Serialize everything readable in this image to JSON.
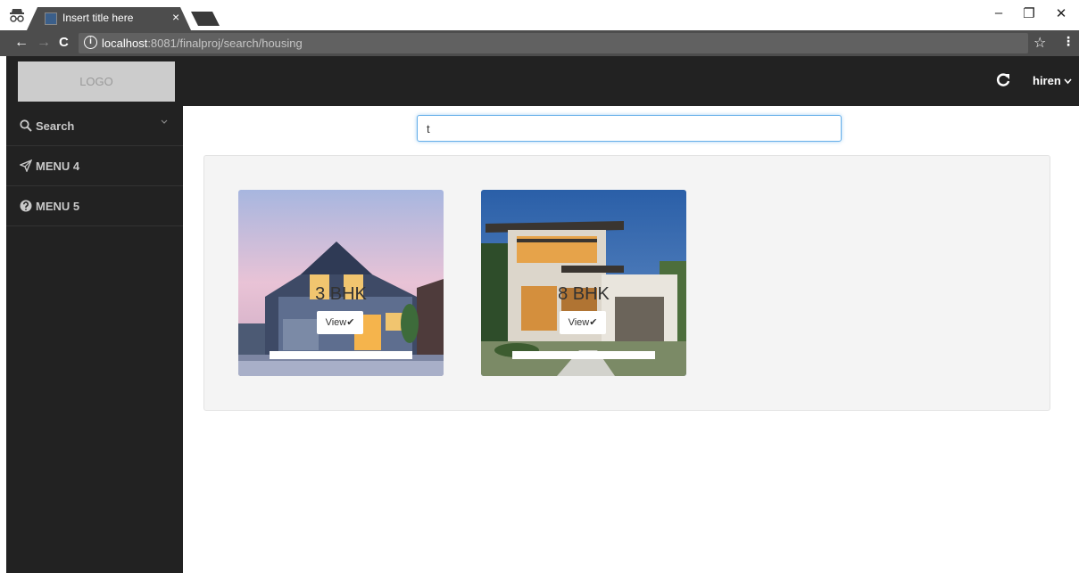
{
  "browser": {
    "tab_title": "Insert title here",
    "tab_close": "×",
    "url_host": "localhost",
    "url_rest": ":8081/finalproj/search/housing",
    "info_glyph": "i",
    "nav_back": "←",
    "nav_forward": "→",
    "nav_reload": "C",
    "bookmark_glyph": "☆",
    "menu_glyph": "⋮",
    "win_minimize": "–",
    "win_restore": "❐",
    "win_close": "✕"
  },
  "header": {
    "logo": "LOGO",
    "user_name": "hiren"
  },
  "sidebar": {
    "items": [
      {
        "label": "Search",
        "icon": "search-icon",
        "has_submenu": true
      },
      {
        "label": "MENU 4",
        "icon": "paper-plane-icon"
      },
      {
        "label": "MENU 5",
        "icon": "question-circle-icon"
      }
    ]
  },
  "search": {
    "value": "t"
  },
  "listings": [
    {
      "label": "3 BHK",
      "button": "View✔"
    },
    {
      "label": "8 BHK",
      "button": "View✔"
    }
  ],
  "colors": {
    "header_bg": "#222222",
    "sidebar_bg": "#222222",
    "address_bar": "#4d4d4d",
    "results_bg": "#f4f4f4",
    "focus_border": "#66afe9"
  }
}
